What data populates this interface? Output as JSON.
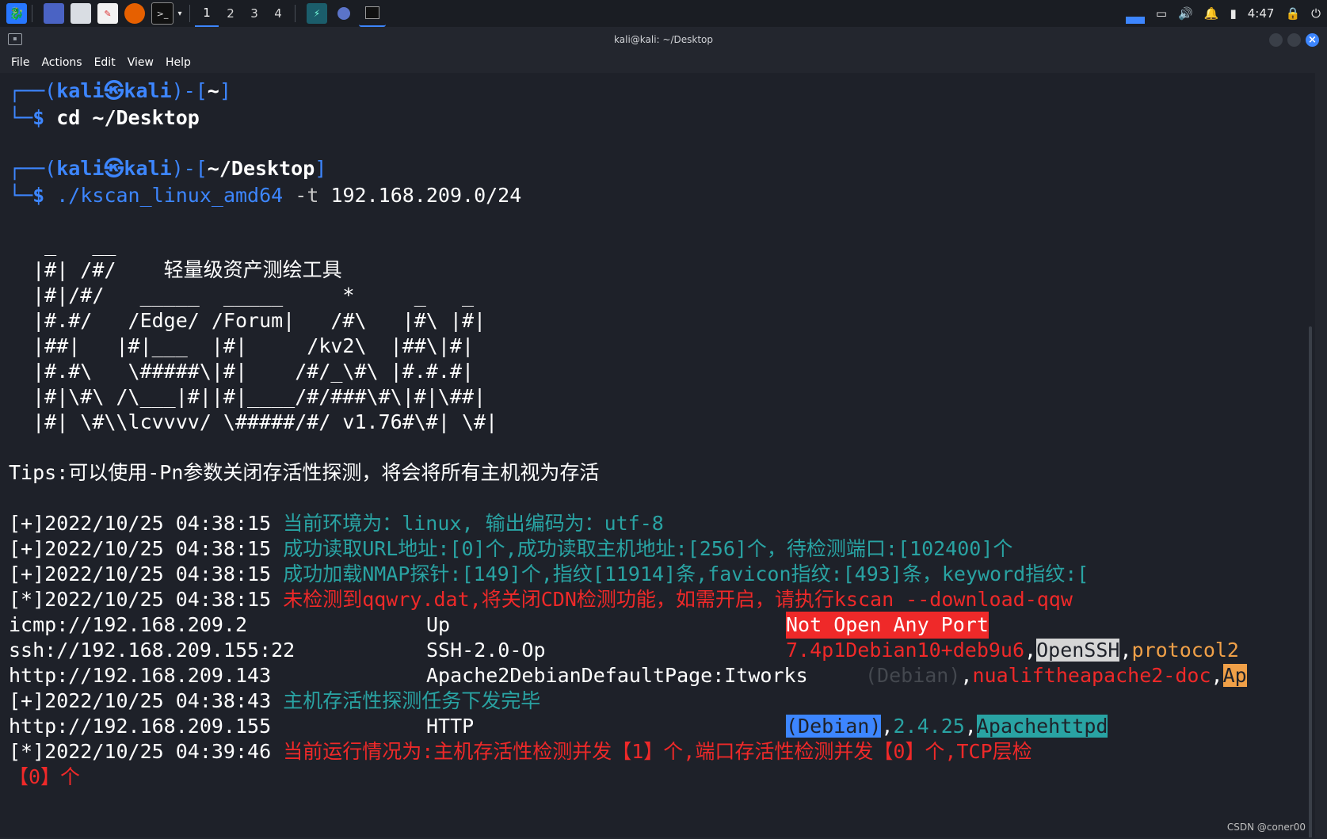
{
  "panel": {
    "workspaces": [
      "1",
      "2",
      "3",
      "4"
    ],
    "time": "4:47"
  },
  "window": {
    "title": "kali@kali: ~/Desktop",
    "menu": [
      "File",
      "Actions",
      "Edit",
      "View",
      "Help"
    ]
  },
  "terminal": {
    "prompt1_user": "kali㉿kali",
    "prompt1_dir": "~",
    "cmd1": "cd ~/Desktop",
    "prompt2_user": "kali㉿kali",
    "prompt2_dir": "~/Desktop",
    "cmd2_exec": "./kscan_linux_amd64",
    "cmd2_flag": "-t",
    "cmd2_arg": "192.168.209.0/24",
    "banner": [
      "   _   __",
      "  |#| /#/    轻量级资产测绘工具",
      "  |#|/#/   _____  _____     *     _   _",
      "  |#.#/   /Edge/ /Forum|   /#\\   |#\\ |#|",
      "  |##|   |#|___  |#|     /kv2\\  |##\\|#|",
      "  |#.#\\   \\#####\\|#|    /#/_\\#\\ |#.#.#|",
      "  |#|\\#\\ /\\___|#||#|____/#/###\\#\\|#|\\##|",
      "  |#| \\#\\\\lcvvvv/ \\#####/#/ v1.76#\\#| \\#|"
    ],
    "tips": "Tips:可以使用-Pn参数关闭存活性探测，将会将所有主机视为存活",
    "log1_prefix": "[+]2022/10/25 04:38:15",
    "log1_msg": "当前环境为：linux, 输出编码为：utf-8",
    "log2_prefix": "[+]2022/10/25 04:38:15",
    "log2_msg": "成功读取URL地址:[0]个,成功读取主机地址:[256]个，待检测端口:[102400]个",
    "log3_prefix": "[+]2022/10/25 04:38:15",
    "log3_msg": "成功加载NMAP探针:[149]个,指纹[11914]条,favicon指纹:[493]条，keyword指纹:[",
    "log4_prefix": "[*]2022/10/25 04:38:15",
    "log4_msg": "未检测到qqwry.dat,将关闭CDN检测功能，如需开启，请执行kscan --download-qqw",
    "r1_url": "icmp://192.168.209.2",
    "r1_status": "Up",
    "r1_info": "Not Open Any Port",
    "r2_url": "ssh://192.168.209.155:22",
    "r2_status": "SSH-2.0-Op",
    "r2_info_a": "7.4p1Debian10+deb9u6",
    "r2_info_b": "OpenSSH",
    "r2_info_c": "protocol2",
    "r3_url": "http://192.168.209.143",
    "r3_status": "Apache2DebianDefaultPage:Itworks",
    "r3_info_a": "(Debian)",
    "r3_info_b": "nualiftheapache2-doc",
    "r3_info_c": "Ap",
    "log5_prefix": "[+]2022/10/25 04:38:43",
    "log5_msg": "主机存活性探测任务下发完毕",
    "r4_url": "http://192.168.209.155",
    "r4_status": "HTTP",
    "r4_info_a": "(Debian)",
    "r4_info_b": "2.4.25",
    "r4_info_c": "Apachehttpd",
    "log6_prefix": "[*]2022/10/25 04:39:46",
    "log6_msg": "当前运行情况为:主机存活性检测并发【1】个,端口存活性检测并发【0】个,TCP层检",
    "log6_cont": "【0】个"
  },
  "watermark": "CSDN @coner00",
  "colors": {
    "accent": "#3d86ff",
    "cyan": "#29a3a3",
    "red": "#ef2929"
  }
}
